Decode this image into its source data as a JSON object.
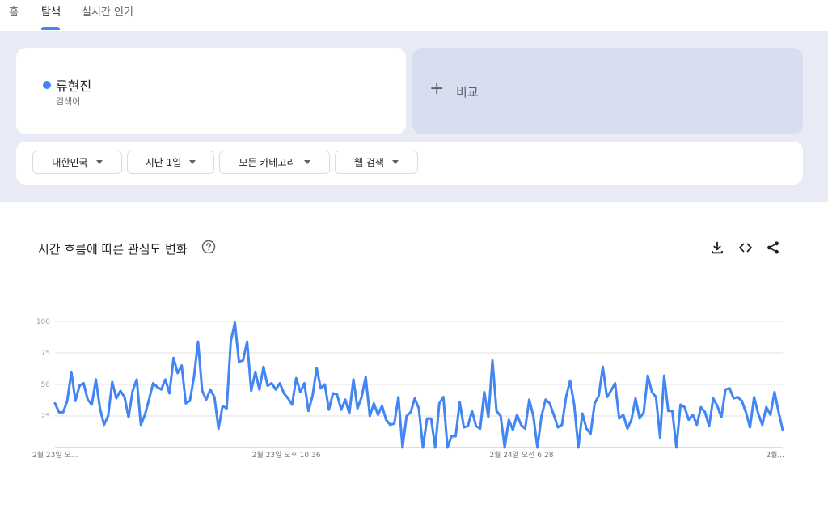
{
  "nav": {
    "tabs": [
      {
        "label": "홈"
      },
      {
        "label": "탐색"
      },
      {
        "label": "실시간 인기"
      }
    ],
    "active_tab": "탐색"
  },
  "term": {
    "name": "류현진",
    "type": "검색어",
    "color": "#4285f4"
  },
  "compare": {
    "plus": "+",
    "label": "비교"
  },
  "filters": [
    {
      "label": "대한민국"
    },
    {
      "label": "지난 1일"
    },
    {
      "label": "모든 카테고리"
    },
    {
      "label": "웹 검색"
    }
  ],
  "chart_panel": {
    "title": "시간 흐름에 따른 관심도 변화",
    "icons": [
      "help-icon",
      "download-icon",
      "embed-code-icon",
      "share-icon"
    ]
  },
  "chart_data": {
    "type": "line",
    "title": "",
    "ylim": [
      0,
      100
    ],
    "yticks": [
      "100",
      "75",
      "50",
      "25"
    ],
    "xtick_labels": [
      "2월 23일 오...",
      "2월 23일 오후 10:36",
      "2월 24일 오전 6:28",
      "2월..."
    ],
    "grid": true,
    "series": [
      {
        "color": "#4285f4",
        "values": [
          35,
          28,
          28,
          37,
          60,
          37,
          49,
          51,
          38,
          34,
          54,
          31,
          18,
          25,
          52,
          39,
          45,
          40,
          24,
          45,
          54,
          18,
          26,
          38,
          51,
          48,
          46,
          54,
          43,
          71,
          59,
          65,
          35,
          37,
          56,
          84,
          45,
          38,
          46,
          40,
          15,
          33,
          31,
          84,
          99,
          68,
          69,
          84,
          45,
          60,
          46,
          64,
          49,
          51,
          46,
          51,
          43,
          39,
          34,
          55,
          44,
          51,
          29,
          41,
          63,
          47,
          50,
          30,
          43,
          42,
          30,
          38,
          27,
          54,
          31,
          40,
          56,
          25,
          35,
          26,
          33,
          22,
          18,
          19,
          40,
          0,
          25,
          28,
          39,
          31,
          0,
          23,
          23,
          0,
          35,
          40,
          0,
          9,
          9,
          36,
          16,
          17,
          29,
          17,
          15,
          44,
          24,
          69,
          29,
          25,
          0,
          22,
          14,
          26,
          18,
          15,
          38,
          25,
          0,
          25,
          38,
          35,
          26,
          16,
          18,
          40,
          53,
          34,
          0,
          27,
          15,
          11,
          35,
          41,
          64,
          40,
          45,
          51,
          23,
          26,
          15,
          22,
          39,
          23,
          28,
          57,
          44,
          40,
          8,
          57,
          29,
          29,
          0,
          34,
          32,
          22,
          26,
          18,
          32,
          28,
          17,
          39,
          33,
          24,
          46,
          47,
          39,
          40,
          37,
          28,
          16,
          40,
          27,
          18,
          32,
          26,
          44,
          28,
          14
        ]
      }
    ]
  }
}
